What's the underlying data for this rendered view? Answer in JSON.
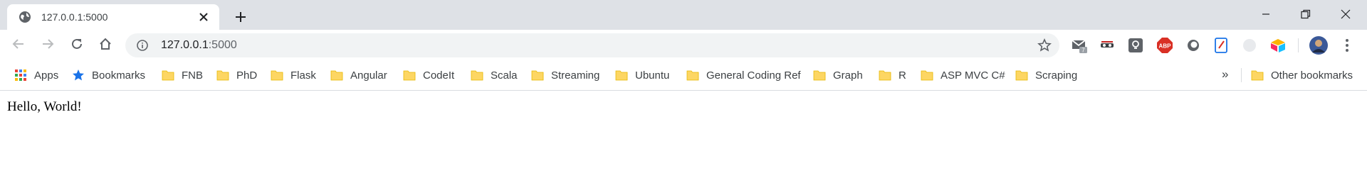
{
  "tab": {
    "title": "127.0.0.1:5000"
  },
  "address": {
    "host": "127.0.0.1",
    "port": ":5000"
  },
  "extensions": [
    "gmail-checker-icon",
    "incognito-icon",
    "keep-icon",
    "adblock-icon",
    "circle-ext-icon",
    "notes-ext-icon",
    "dark-mode-icon",
    "airtable-icon"
  ],
  "extension_badges": {
    "gmail": "7",
    "adblock": "ABP"
  },
  "bookmarks": [
    {
      "label": "Apps",
      "icon": "apps-grid-icon"
    },
    {
      "label": "Bookmarks",
      "icon": "star-icon"
    },
    {
      "label": "FNB",
      "icon": "folder-icon"
    },
    {
      "label": "PhD",
      "icon": "folder-icon"
    },
    {
      "label": "Flask",
      "icon": "folder-icon"
    },
    {
      "label": "Angular",
      "icon": "folder-icon"
    },
    {
      "label": "CodeIt",
      "icon": "folder-icon"
    },
    {
      "label": "Scala",
      "icon": "folder-icon"
    },
    {
      "label": "Streaming",
      "icon": "folder-icon"
    },
    {
      "label": "Ubuntu",
      "icon": "folder-icon"
    },
    {
      "label": "General Coding Ref",
      "icon": "folder-icon"
    },
    {
      "label": "Graph",
      "icon": "folder-icon"
    },
    {
      "label": "R",
      "icon": "folder-icon"
    },
    {
      "label": "ASP MVC C#",
      "icon": "folder-icon"
    },
    {
      "label": "Scraping",
      "icon": "folder-icon"
    }
  ],
  "overflow_label": "»",
  "other_bookmarks": "Other bookmarks",
  "page": {
    "text": "Hello, World!"
  },
  "colors": {
    "tabstrip": "#dee1e6",
    "folder": "#fdd663",
    "omnibox": "#f1f3f4"
  }
}
